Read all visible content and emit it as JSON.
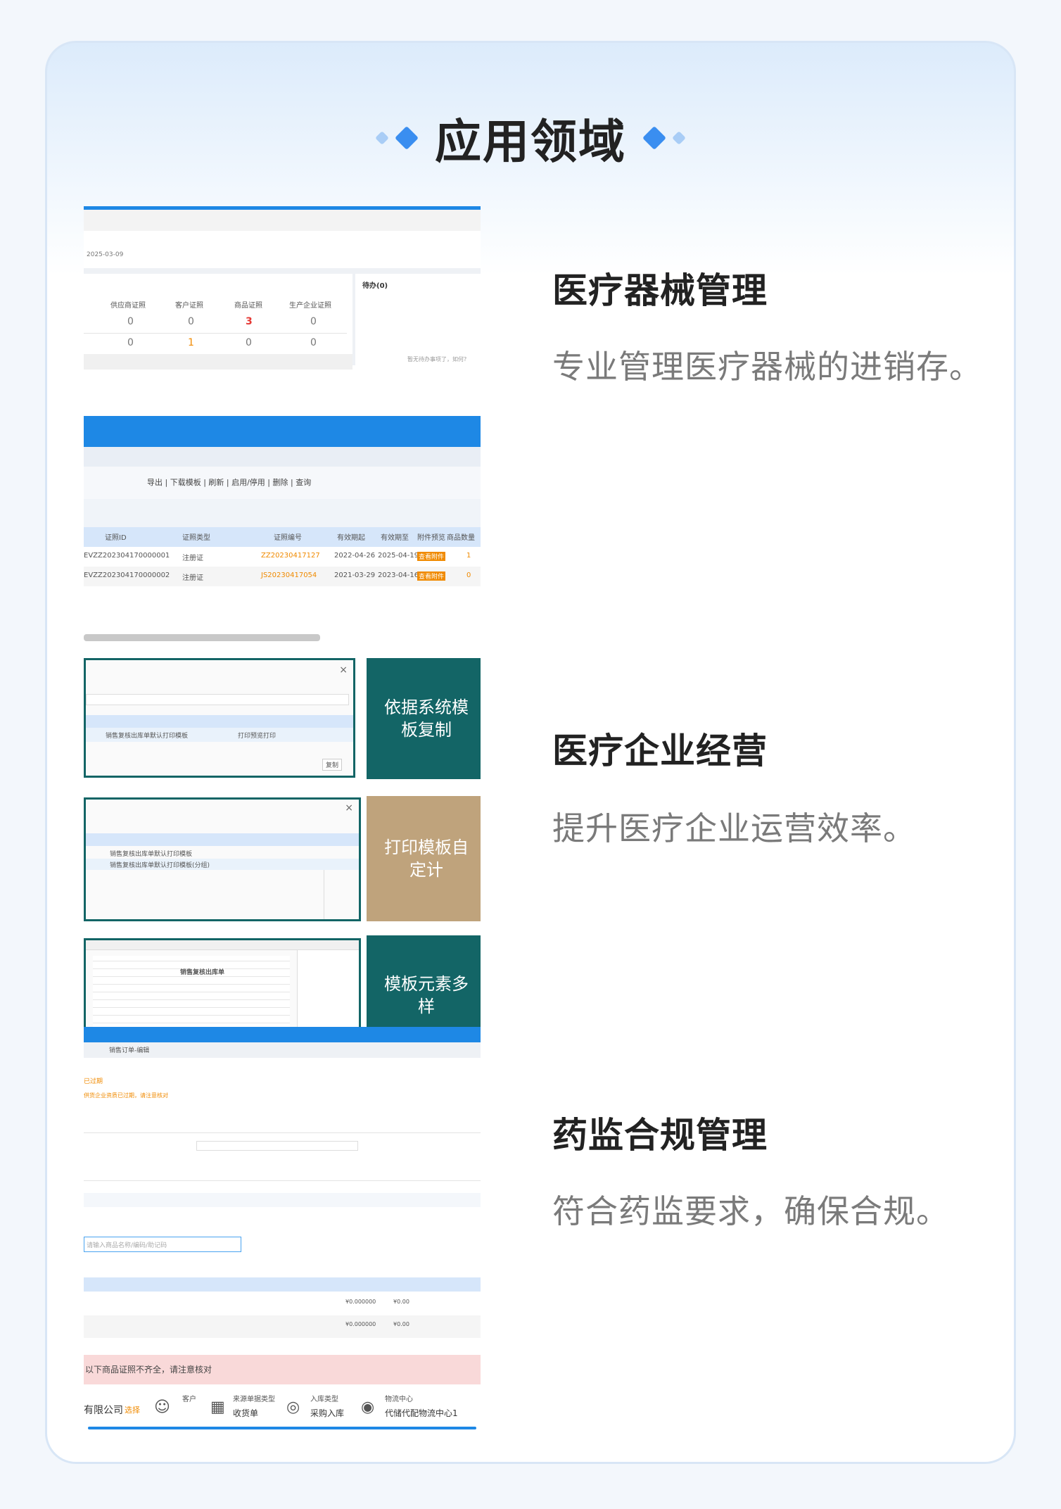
{
  "header": {
    "title": "应用领域"
  },
  "features": [
    {
      "title": "医疗器械管理",
      "desc": "专业管理医疗器械的进销存。"
    },
    {
      "title": "医疗企业经营",
      "desc": "提升医疗企业运营效率。"
    },
    {
      "title": "药监合规管理",
      "desc": "符合药监要求，确保合规。"
    }
  ],
  "shot1": {
    "date": "2025-03-09",
    "todo": "待办(0)",
    "headers": [
      "供应商证照",
      "客户证照",
      "商品证照",
      "生产企业证照"
    ],
    "row1": [
      "0",
      "0",
      "3",
      "0"
    ],
    "row2": [
      "0",
      "1",
      "0",
      "0"
    ],
    "note": "暂无待办事项了，如何?"
  },
  "shot2": {
    "toolbar": "导出 | 下载模板 | 刷新 | 启用/停用 | 删除 | 查询",
    "headers": [
      "证照ID",
      "证照类型",
      "证照编号",
      "有效期起",
      "有效期至",
      "附件预览",
      "商品数量"
    ],
    "rows": [
      [
        "EVZZ202304170000001",
        "注册证",
        "ZZ20230417127",
        "2022-04-26",
        "2025-04-19",
        "查看附件",
        "1"
      ],
      [
        "EVZZ202304170000002",
        "注册证",
        "JS20230417054",
        "2021-03-29",
        "2023-04-16",
        "查看附件",
        "0"
      ]
    ]
  },
  "shot3": {
    "tile1": "依据系统模板复制",
    "tile2": "打印模板自定计",
    "tile3": "模板元素多样",
    "dialog1_row": "销售复核出库单默认打印模板",
    "dialog1_mode": "打印预览打印",
    "dialog1_btn": "复制",
    "dialog2_row1": "销售复核出库单默认打印模板",
    "dialog2_row2": "销售复核出库单默认打印模板(分组)",
    "sheet_title": "销售复核出库单"
  },
  "shot4": {
    "tab": "销售订单-编辑",
    "status": "已过期",
    "hint1": "供货企业资质已过期，请注意核对",
    "search_placeholder": "请输入商品名称/编码/助记码",
    "warning": "以下商品证照不齐全，请注意核对",
    "company": "有限公司",
    "select": "选择",
    "customer_label": "客户",
    "source_label": "来源单据类型",
    "source_value": "收货单",
    "in_label": "入库类型",
    "in_value": "采购入库",
    "logistics_label": "物流中心",
    "logistics_value": "代储代配物流中心1",
    "unit_price": "¥0.000000",
    "amount": "¥0.00"
  }
}
